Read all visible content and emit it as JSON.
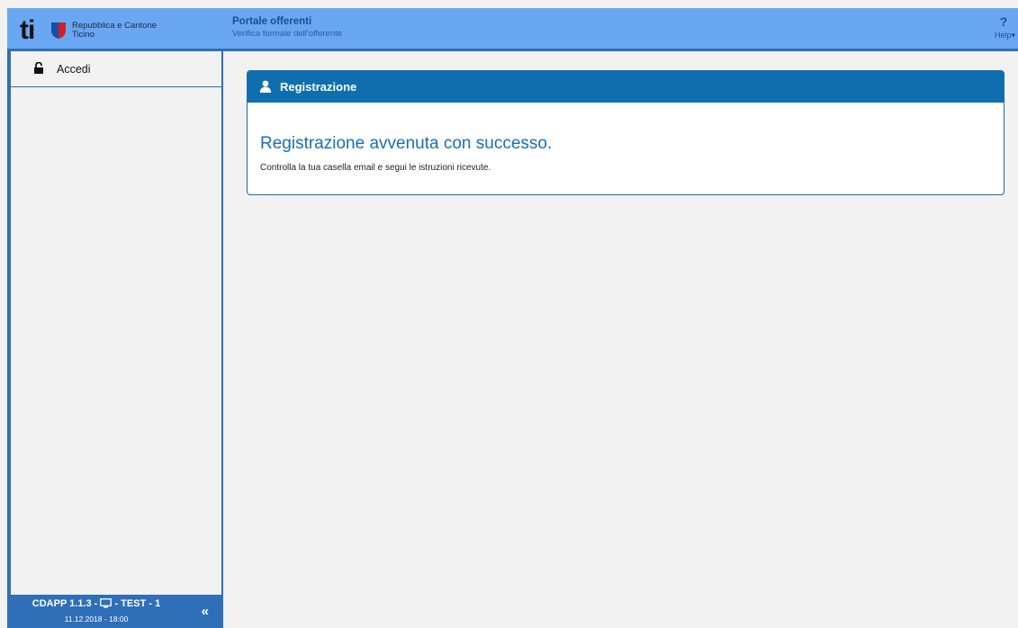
{
  "header": {
    "logo_ti": "ti",
    "logo_text_line1": "Repubblica e Cantone",
    "logo_text_line2": "Ticino",
    "portal_title": "Portale offerenti",
    "portal_subtitle": "Verifica formale dell'offerente",
    "help_icon": "?",
    "help_label": "Help▾"
  },
  "sidebar": {
    "items": [
      {
        "label": "Accedi",
        "icon": "lock-open-icon"
      }
    ],
    "footer": {
      "version_prefix": "CDAPP 1.1.3 - ",
      "version_suffix": " - TEST - 1",
      "date": "11.12.2018 - 18:00",
      "collapse": "«"
    }
  },
  "panel": {
    "title": "Registrazione",
    "icon": "user-icon",
    "success_heading": "Registrazione avvenuta con successo.",
    "success_text": "Controlla la tua casella email e segui le istruzioni ricevute."
  },
  "colors": {
    "header_bg": "#6aa7f3",
    "accent_blue": "#2f6fb7",
    "panel_header": "#0f6fae",
    "background": "#f2f2f2"
  }
}
